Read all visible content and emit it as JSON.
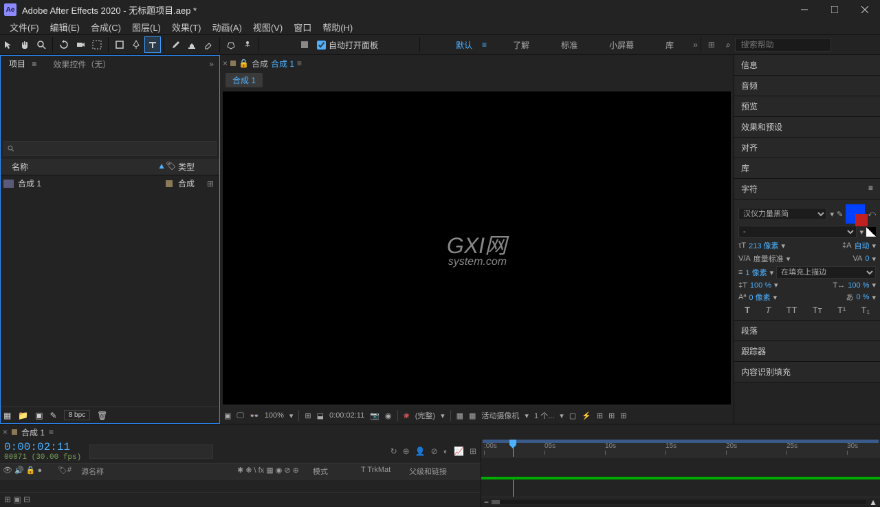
{
  "title": "Adobe After Effects 2020 - 无标题项目.aep *",
  "logo": "Ae",
  "menu": [
    "文件(F)",
    "编辑(E)",
    "合成(C)",
    "图层(L)",
    "效果(T)",
    "动画(A)",
    "视图(V)",
    "窗口",
    "帮助(H)"
  ],
  "toolbar_checkbox": "自动打开面板",
  "workspaces": {
    "items": [
      "默认",
      "了解",
      "标准",
      "小屏幕",
      "库"
    ],
    "active": "默认"
  },
  "search_help_placeholder": "搜索帮助",
  "left": {
    "tabs": {
      "project": "项目",
      "effect_controls": "效果控件（无）"
    },
    "search_icon_label": "search",
    "cols": {
      "name": "名称",
      "type": "类型"
    },
    "row": {
      "name": "合成 1",
      "type": "合成"
    },
    "footer_bpc": "8 bpc"
  },
  "comp": {
    "header_prefix": "合成",
    "name": "合成 1",
    "tab": "合成 1"
  },
  "watermark": {
    "main": "GXI网",
    "sub": "system.com"
  },
  "viewer": {
    "zoom": "100%",
    "time": "0:00:02:11",
    "res": "(完整)",
    "camera": "活动摄像机",
    "views": "1 个..."
  },
  "right": {
    "panels": [
      "信息",
      "音频",
      "预览",
      "效果和预设",
      "对齐",
      "库"
    ],
    "char_title": "字符",
    "font": "汉仪力量黑简",
    "font_style": "-",
    "size": "213 像素",
    "leading": "自动",
    "kerning": "度量标准",
    "tracking": "0",
    "stroke": "1 像素",
    "stroke_mode": "在填充上描边",
    "vscale": "100 %",
    "hscale": "100 %",
    "baseline": "0 像素",
    "tsume": "0 %",
    "extra": [
      "段落",
      "跟踪器",
      "内容识别填充"
    ]
  },
  "timeline": {
    "tab": "合成 1",
    "time": "0:00:02:11",
    "frames": "00071 (30.00 fps)",
    "cols": {
      "source": "源名称",
      "switch": "半 \\ fx 圆",
      "mode": "模式",
      "trkmat": "TrkMat",
      "parent": "父级和链接"
    },
    "ticks": [
      ":00s",
      "05s",
      "10s",
      "15s",
      "20s",
      "25s",
      "30s"
    ]
  }
}
